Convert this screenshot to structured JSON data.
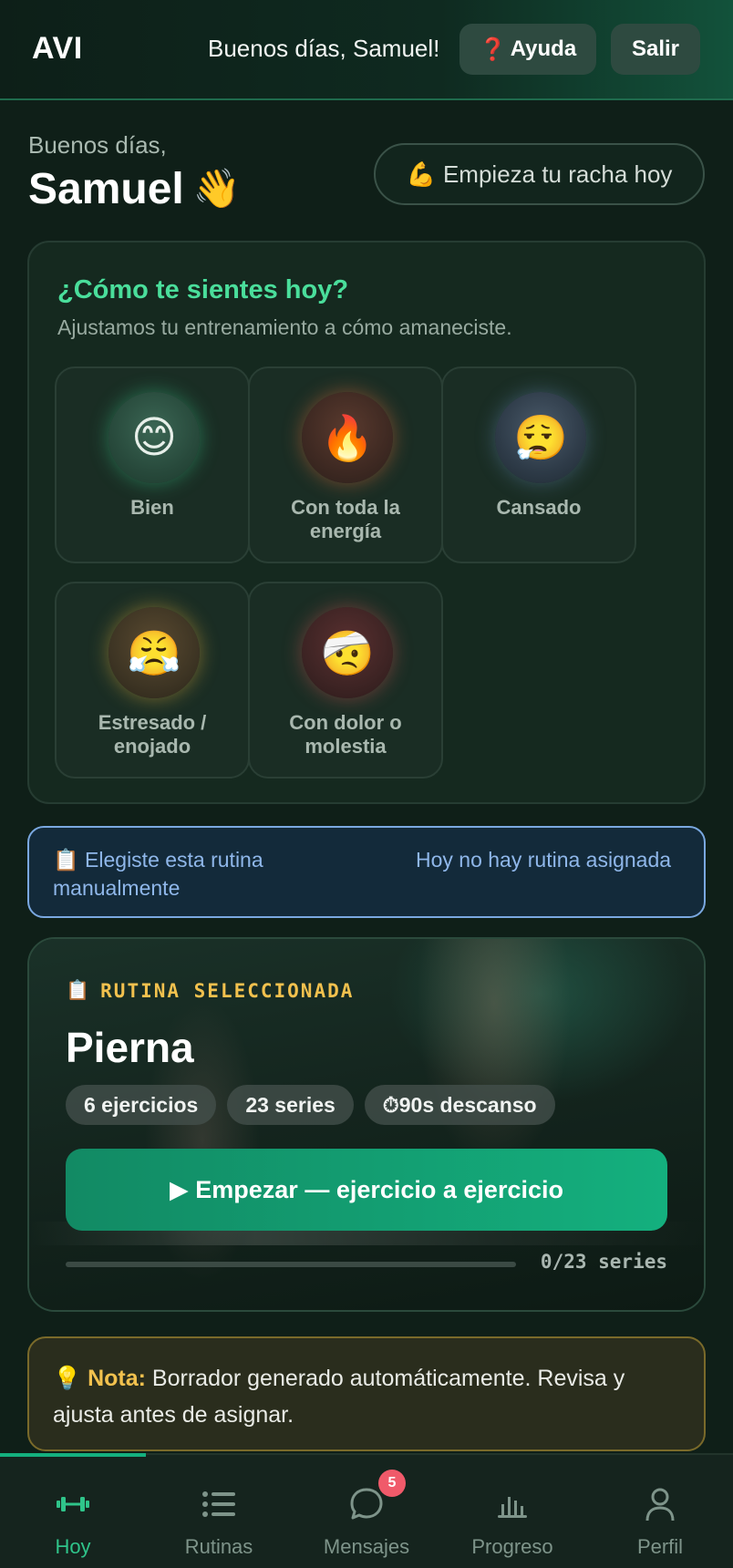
{
  "header": {
    "logo": "AVI",
    "greeting": "Buenos días, Samuel!",
    "help_label": "Ayuda",
    "help_icon": "❓",
    "exit_label": "Salir"
  },
  "welcome": {
    "hello": "Buenos días,",
    "name": "Samuel",
    "wave_emoji": "👋",
    "streak_icon": "💪",
    "streak_label": "Empieza tu racha hoy"
  },
  "mood": {
    "title": "¿Cómo te sientes hoy?",
    "subtitle": "Ajustamos tu entrenamiento a cómo amaneciste.",
    "options": [
      {
        "emoji": "😊",
        "label": "Bien",
        "color": "#3cc88c"
      },
      {
        "emoji": "🔥",
        "label": "Con toda la energía",
        "color": "#f06e3c"
      },
      {
        "emoji": "😮‍💨",
        "label": "Cansado",
        "color": "#78a0dc"
      },
      {
        "emoji": "😤",
        "label": "Estresado / enojado",
        "color": "#f0b43c"
      },
      {
        "emoji": "🤕",
        "label": "Con dolor o molestia",
        "color": "#f05a5a"
      }
    ]
  },
  "banner": {
    "left_icon": "📋",
    "left_text": "Elegiste esta rutina manualmente",
    "right_text": "Hoy no hay rutina asignada"
  },
  "routine": {
    "tag_icon": "📋",
    "tag": "RUTINA SELECCIONADA",
    "title": "Pierna",
    "chips": [
      "6 ejercicios",
      "23 series",
      "⏱90s descanso"
    ],
    "start_label": "▶ Empezar — ejercicio a ejercicio",
    "progress_done": 0,
    "progress_total": 23,
    "progress_text": "0/23 series"
  },
  "note": {
    "icon": "💡",
    "label": "Nota:",
    "text": " Borrador generado automáticamente. Revisa y ajusta antes de asignar."
  },
  "nav": {
    "items": [
      {
        "label": "Hoy",
        "icon": "dumbbell-icon",
        "active": true
      },
      {
        "label": "Rutinas",
        "icon": "list-icon",
        "active": false
      },
      {
        "label": "Mensajes",
        "icon": "chat-icon",
        "active": false,
        "badge": "5"
      },
      {
        "label": "Progreso",
        "icon": "chart-icon",
        "active": false
      },
      {
        "label": "Perfil",
        "icon": "user-icon",
        "active": false
      }
    ],
    "accent": "#2fc48a"
  }
}
